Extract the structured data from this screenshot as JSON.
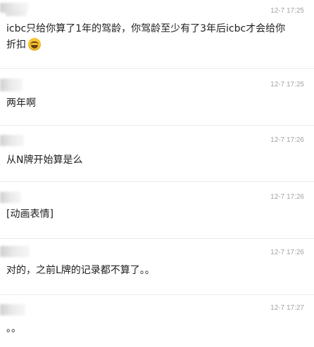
{
  "comments": [
    {
      "timestamp": "12-7 17:25",
      "text": "icbc只给你算了1年的驾龄，你驾龄至少有了3年后icbc才会给你",
      "text2": "折扣",
      "emoji": "laughing-crying-emoji"
    },
    {
      "timestamp": "12-7 17:25",
      "text": "两年啊"
    },
    {
      "timestamp": "12-7 17:26",
      "text": "从N牌开始算是么"
    },
    {
      "timestamp": "12-7 17:26",
      "text": "[动画表情]"
    },
    {
      "timestamp": "12-7 17:26",
      "text": "对的，之前L牌的记录都不算了。。"
    },
    {
      "timestamp": "12-7 17:27",
      "text": "。。"
    }
  ]
}
